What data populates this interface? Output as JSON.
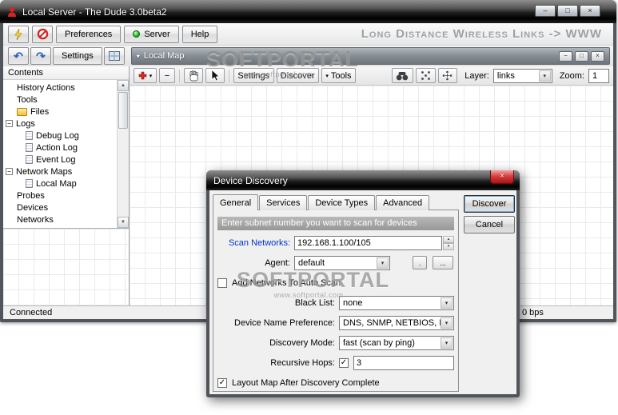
{
  "window": {
    "title": "Local Server - The Dude 3.0beta2"
  },
  "icons": {
    "minimize": "–",
    "maximize": "□",
    "close": "×",
    "dropdown": "▾",
    "up": "▴",
    "down": "▾",
    "undo": "↶",
    "redo": "↷",
    "check": "✓",
    "collapse": "−",
    "minus": "−",
    "scroll_up": "▲",
    "scroll_down": "▼"
  },
  "toolbar": {
    "preferences": "Preferences",
    "server": "Server",
    "help": "Help",
    "banner": "Long Distance Wireless Links -> WWW"
  },
  "editbar": {
    "settings": "Settings"
  },
  "map_header": {
    "title": "Local Map"
  },
  "map_toolbar": {
    "settings": "Settings",
    "discover": "Discover",
    "tools": "Tools",
    "layer_label": "Layer:",
    "layer_value": "links",
    "zoom_label": "Zoom:",
    "zoom_value": "1"
  },
  "sidebar": {
    "header": "Contents",
    "items": [
      {
        "label": "History Actions"
      },
      {
        "label": "Tools"
      },
      {
        "label": "Files"
      },
      {
        "label": "Logs"
      },
      {
        "label": "Debug Log"
      },
      {
        "label": "Action Log"
      },
      {
        "label": "Event Log"
      },
      {
        "label": "Network Maps"
      },
      {
        "label": "Local Map"
      },
      {
        "label": "Probes"
      },
      {
        "label": "Devices"
      },
      {
        "label": "Networks"
      }
    ]
  },
  "statusbar": {
    "connection": "Connected",
    "rate": "0 bps"
  },
  "dialog": {
    "title": "Device Discovery",
    "tabs": [
      "General",
      "Services",
      "Device Types",
      "Advanced"
    ],
    "hint": "Enter subnet number you want to scan for devices",
    "scan_networks_label": "Scan Networks:",
    "scan_networks_value": "192.168.1.100/105",
    "agent_label": "Agent:",
    "agent_value": "default",
    "agent_button_small": ".",
    "agent_button_more": "...",
    "add_networks_label": "Add Networks To Auto Scan",
    "black_list_label": "Black List:",
    "black_list_value": "none",
    "device_name_label": "Device Name Preference:",
    "device_name_value": "DNS, SNMP, NETBIOS, IP",
    "discovery_mode_label": "Discovery Mode:",
    "discovery_mode_value": "fast (scan by ping)",
    "recursive_hops_label": "Recursive Hops:",
    "recursive_hops_value": "3",
    "layout_map_label": "Layout Map After Discovery Complete",
    "discover_button": "Discover",
    "cancel_button": "Cancel"
  },
  "watermark": {
    "text": "SOFTPORTAL",
    "url": "www.softportal.com"
  }
}
